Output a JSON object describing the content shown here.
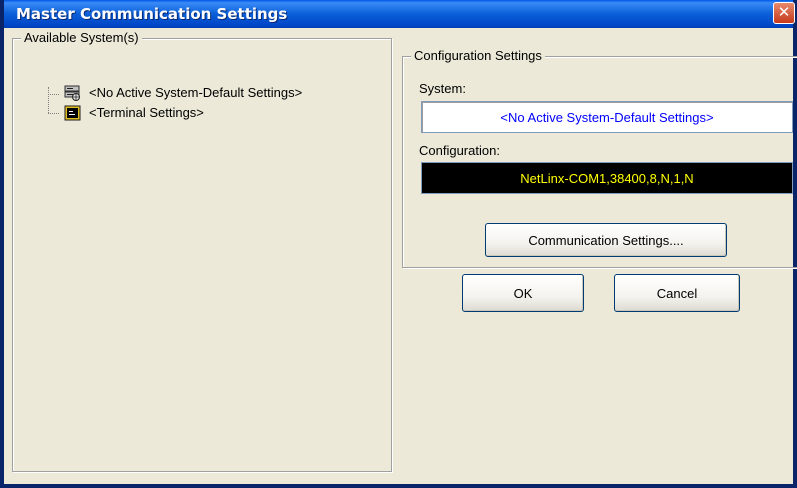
{
  "window": {
    "title": "Master Communication Settings",
    "close_glyph": "✕"
  },
  "available_systems": {
    "legend": "Available System(s)",
    "items": [
      {
        "label": "<No Active System-Default Settings>",
        "icon": "network-system-icon",
        "selected": true
      },
      {
        "label": "<Terminal Settings>",
        "icon": "terminal-icon",
        "selected": false
      }
    ]
  },
  "configuration": {
    "legend": "Configuration Settings",
    "system_label": "System:",
    "system_value": "<No Active System-Default Settings>",
    "configuration_label": "Configuration:",
    "configuration_value": "NetLinx-COM1,38400,8,N,1,N",
    "comm_button_label": "Communication Settings...."
  },
  "buttons": {
    "ok_label": "OK",
    "cancel_label": "Cancel"
  },
  "colors": {
    "titlebar": "#0a5fd8",
    "dialog_bg": "#ece9d8",
    "system_value_text": "#0000ff",
    "config_field_bg": "#000000",
    "config_value_text": "#ffff00"
  }
}
